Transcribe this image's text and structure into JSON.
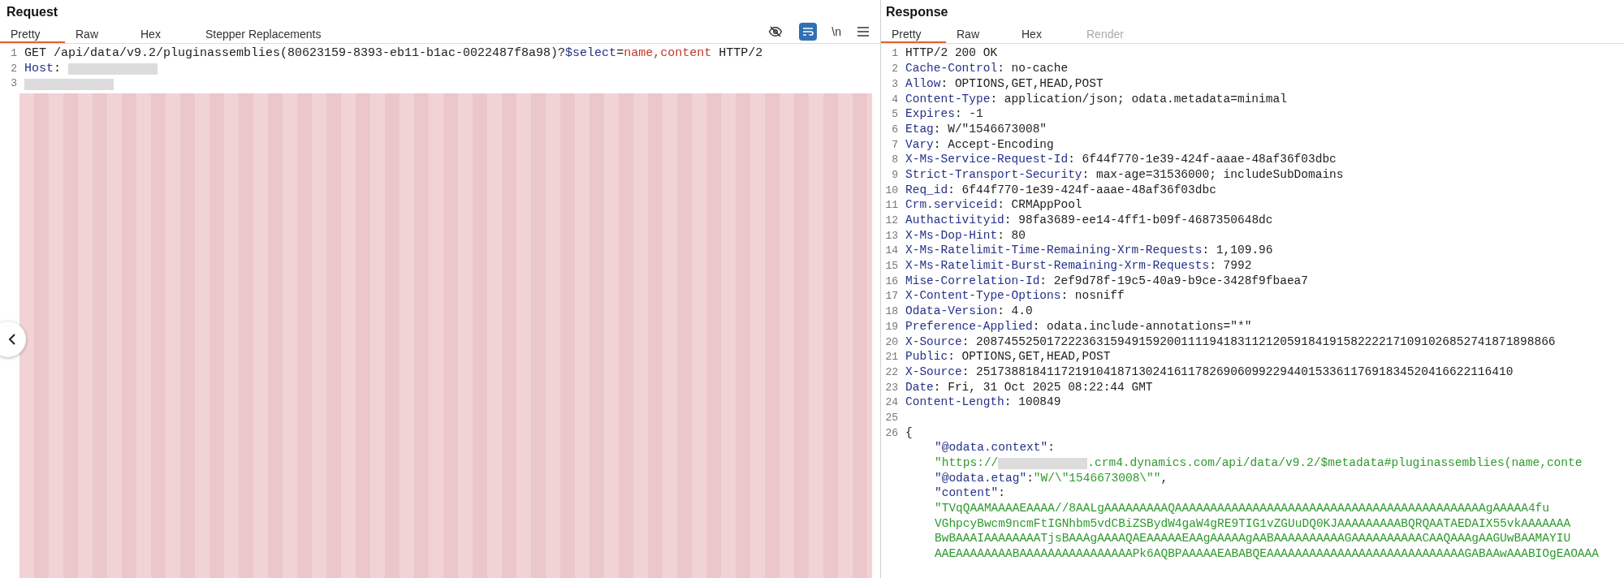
{
  "request": {
    "title": "Request",
    "tabs": [
      {
        "label": "Pretty",
        "selected": true,
        "disabled": false
      },
      {
        "label": "Raw",
        "selected": false,
        "disabled": false
      },
      {
        "label": "Hex",
        "selected": false,
        "disabled": false
      },
      {
        "label": "Stepper Replacements",
        "selected": false,
        "disabled": false
      }
    ],
    "toolbar": {
      "hide_on": false,
      "wrap_on": true,
      "newline_label": "\\n"
    },
    "lines": [
      {
        "number": "1",
        "segments": [
          {
            "kind": "plain",
            "text": "GET /api/data/v9.2/pluginassemblies(80623159-8393-eb11-b1ac-0022487f8a98)?"
          },
          {
            "kind": "key",
            "text": "$select"
          },
          {
            "kind": "plain",
            "text": "="
          },
          {
            "kind": "param",
            "text": "name,content"
          },
          {
            "kind": "plain",
            "text": " HTTP/2"
          }
        ]
      },
      {
        "number": "2",
        "segments": [
          {
            "kind": "key",
            "text": "Host"
          },
          {
            "kind": "plain",
            "text": ": "
          },
          {
            "kind": "redacted"
          }
        ]
      },
      {
        "number": "3",
        "segments": [
          {
            "kind": "redacted"
          }
        ]
      }
    ]
  },
  "response": {
    "title": "Response",
    "tabs": [
      {
        "label": "Pretty",
        "selected": true,
        "disabled": false
      },
      {
        "label": "Raw",
        "selected": false,
        "disabled": false
      },
      {
        "label": "Hex",
        "selected": false,
        "disabled": false
      },
      {
        "label": "Render",
        "selected": false,
        "disabled": true
      }
    ],
    "lines": [
      {
        "number": "1",
        "segments": [
          {
            "kind": "plain",
            "text": "HTTP/2 200 OK"
          }
        ]
      },
      {
        "number": "2",
        "segments": [
          {
            "kind": "key",
            "text": "Cache-Control"
          },
          {
            "kind": "plain",
            "text": ": no-cache"
          }
        ]
      },
      {
        "number": "3",
        "segments": [
          {
            "kind": "key",
            "text": "Allow"
          },
          {
            "kind": "plain",
            "text": ": OPTIONS,GET,HEAD,POST"
          }
        ]
      },
      {
        "number": "4",
        "segments": [
          {
            "kind": "key",
            "text": "Content-Type"
          },
          {
            "kind": "plain",
            "text": ": application/json; odata.metadata=minimal"
          }
        ]
      },
      {
        "number": "5",
        "segments": [
          {
            "kind": "key",
            "text": "Expires"
          },
          {
            "kind": "plain",
            "text": ": -1"
          }
        ]
      },
      {
        "number": "6",
        "segments": [
          {
            "kind": "key",
            "text": "Etag"
          },
          {
            "kind": "plain",
            "text": ": W/\"1546673008\""
          }
        ]
      },
      {
        "number": "7",
        "segments": [
          {
            "kind": "key",
            "text": "Vary"
          },
          {
            "kind": "plain",
            "text": ": Accept-Encoding"
          }
        ]
      },
      {
        "number": "8",
        "segments": [
          {
            "kind": "key",
            "text": "X-Ms-Service-Request-Id"
          },
          {
            "kind": "plain",
            "text": ": 6f44f770-1e39-424f-aaae-48af36f03dbc"
          }
        ]
      },
      {
        "number": "9",
        "segments": [
          {
            "kind": "key",
            "text": "Strict-Transport-Security"
          },
          {
            "kind": "plain",
            "text": ": max-age=31536000; includeSubDomains"
          }
        ]
      },
      {
        "number": "10",
        "segments": [
          {
            "kind": "key",
            "text": "Req_id"
          },
          {
            "kind": "plain",
            "text": ": 6f44f770-1e39-424f-aaae-48af36f03dbc"
          }
        ]
      },
      {
        "number": "11",
        "segments": [
          {
            "kind": "key",
            "text": "Crm.serviceid"
          },
          {
            "kind": "plain",
            "text": ": CRMAppPool"
          }
        ]
      },
      {
        "number": "12",
        "segments": [
          {
            "kind": "key",
            "text": "Authactivityid"
          },
          {
            "kind": "plain",
            "text": ": 98fa3689-ee14-4ff1-b09f-4687350648dc"
          }
        ]
      },
      {
        "number": "13",
        "segments": [
          {
            "kind": "key",
            "text": "X-Ms-Dop-Hint"
          },
          {
            "kind": "plain",
            "text": ": 80"
          }
        ]
      },
      {
        "number": "14",
        "segments": [
          {
            "kind": "key",
            "text": "X-Ms-Ratelimit-Time-Remaining-Xrm-Requests"
          },
          {
            "kind": "plain",
            "text": ": 1,109.96"
          }
        ]
      },
      {
        "number": "15",
        "segments": [
          {
            "kind": "key",
            "text": "X-Ms-Ratelimit-Burst-Remaining-Xrm-Requests"
          },
          {
            "kind": "plain",
            "text": ": 7992"
          }
        ]
      },
      {
        "number": "16",
        "segments": [
          {
            "kind": "key",
            "text": "Mise-Correlation-Id"
          },
          {
            "kind": "plain",
            "text": ": 2ef9d78f-19c5-40a9-b9ce-3428f9fbaea7"
          }
        ]
      },
      {
        "number": "17",
        "segments": [
          {
            "kind": "key",
            "text": "X-Content-Type-Options"
          },
          {
            "kind": "plain",
            "text": ": nosniff"
          }
        ]
      },
      {
        "number": "18",
        "segments": [
          {
            "kind": "key",
            "text": "Odata-Version"
          },
          {
            "kind": "plain",
            "text": ": 4.0"
          }
        ]
      },
      {
        "number": "19",
        "segments": [
          {
            "kind": "key",
            "text": "Preference-Applied"
          },
          {
            "kind": "plain",
            "text": ": odata.include-annotations=\"*\""
          }
        ]
      },
      {
        "number": "20",
        "segments": [
          {
            "kind": "key",
            "text": "X-Source"
          },
          {
            "kind": "plain",
            "text": ": 2087455250172223631594915920011119418311212059184191582222171091026852741871898866"
          }
        ]
      },
      {
        "number": "21",
        "segments": [
          {
            "kind": "key",
            "text": "Public"
          },
          {
            "kind": "plain",
            "text": ": OPTIONS,GET,HEAD,POST"
          }
        ]
      },
      {
        "number": "22",
        "segments": [
          {
            "kind": "key",
            "text": "X-Source"
          },
          {
            "kind": "plain",
            "text": ": 2517388184117219104187130241611782690609922944015336117691834520416622116410"
          }
        ]
      },
      {
        "number": "23",
        "segments": [
          {
            "kind": "key",
            "text": "Date"
          },
          {
            "kind": "plain",
            "text": ": Fri, 31 Oct 2025 08:22:44 GMT"
          }
        ]
      },
      {
        "number": "24",
        "segments": [
          {
            "kind": "key",
            "text": "Content-Length"
          },
          {
            "kind": "plain",
            "text": ": 100849"
          }
        ]
      },
      {
        "number": "25"
      },
      {
        "number": "26",
        "segments": [
          {
            "kind": "plain",
            "text": "{"
          }
        ],
        "children": [
          {
            "segments": [
              {
                "kind": "key",
                "text": "\"@odata.context\""
              },
              {
                "kind": "plain",
                "text": ":"
              }
            ]
          },
          {
            "segments": [
              {
                "kind": "string",
                "text": "\"https://"
              },
              {
                "kind": "redacted"
              },
              {
                "kind": "string",
                "text": ".crm4.dynamics.com/api/data/v9.2/$metadata#pluginassemblies(name,conte"
              }
            ]
          },
          {
            "segments": [
              {
                "kind": "key",
                "text": "\"@odata.etag\""
              },
              {
                "kind": "plain",
                "text": ":"
              },
              {
                "kind": "string",
                "text": "\"W/\\\"1546673008\\\"\""
              },
              {
                "kind": "plain",
                "text": ","
              }
            ]
          },
          {
            "segments": [
              {
                "kind": "key",
                "text": "\"content\""
              },
              {
                "kind": "plain",
                "text": ":"
              }
            ]
          },
          {
            "segments": [
              {
                "kind": "string",
                "text": "\"TVqQAAMAAAAEAAAA//8AALgAAAAAAAAAQAAAAAAAAAAAAAAAAAAAAAAAAAAAAAAAAAAAAAAAAAAAAgAAAAA4fu"
              }
            ]
          },
          {
            "segments": [
              {
                "kind": "string",
                "text": "VGhpcyBwcm9ncmFtIGNhbm5vdCBiZSBydW4gaW4gRE9TIG1vZGUuDQ0KJAAAAAAAAABQRQAATAEDAIX55vkAAAAAAA"
              }
            ]
          },
          {
            "segments": [
              {
                "kind": "string",
                "text": "BwBAAAIAAAAAAAATjsBAAAgAAAAQAEAAAAAEAAgAAAAAgAABAAAAAAAAAAGAAAAAAAAAACAAQAAAgAAGUwBAAMAYIU"
              }
            ]
          },
          {
            "segments": [
              {
                "kind": "string",
                "text": "AAEAAAAAAAABAAAAAAAAAAAAAAAAPk6AQBPAAAAAEABABQEAAAAAAAAAAAAAAAAAAAAAAAAAAAAGABAAwAAABIOgEAOAAA"
              }
            ]
          }
        ]
      }
    ]
  }
}
